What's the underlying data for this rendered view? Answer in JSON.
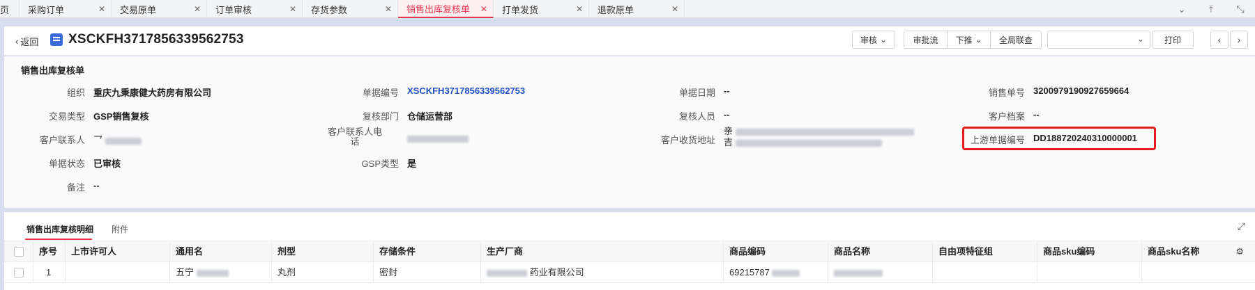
{
  "tabs": [
    {
      "label": "页",
      "closable": false
    },
    {
      "label": "采购订单",
      "closable": true
    },
    {
      "label": "交易原单",
      "closable": true
    },
    {
      "label": "订单审核",
      "closable": true
    },
    {
      "label": "存货参数",
      "closable": true
    },
    {
      "label": "销售出库复核单",
      "closable": true,
      "active": true
    },
    {
      "label": "打单发货",
      "closable": true
    },
    {
      "label": "退款原单",
      "closable": true
    }
  ],
  "header": {
    "back_label": "返回",
    "doc_number": "XSCKFH3717856339562753",
    "buttons": {
      "audit": "审核",
      "approval_flow": "审批流",
      "push_down": "下推",
      "global_link": "全局联查",
      "print_template": "",
      "print": "打印"
    }
  },
  "form": {
    "title": "销售出库复核单",
    "fields": {
      "org": {
        "label": "组织",
        "value": "重庆九秉康健大药房有限公司"
      },
      "doc_no": {
        "label": "单据编号",
        "value": "XSCKFH3717856339562753"
      },
      "doc_date": {
        "label": "单据日期",
        "value": "--"
      },
      "sales_no": {
        "label": "销售单号",
        "value": "3200979190927659664"
      },
      "trade_type": {
        "label": "交易类型",
        "value": "GSP销售复核"
      },
      "review_dept": {
        "label": "复核部门",
        "value": "仓储运营部"
      },
      "reviewer": {
        "label": "复核人员",
        "value": "--"
      },
      "customer_file": {
        "label": "客户档案",
        "value": "--"
      },
      "contact": {
        "label": "客户联系人",
        "value": "乛"
      },
      "contact_phone": {
        "label_line1": "客户联系人电",
        "label_line2": "话",
        "value": ""
      },
      "address": {
        "label": "客户收货地址",
        "value_line1": "亲",
        "value_line2": "吉"
      },
      "upstream_no": {
        "label": "上游单据编号",
        "value": "DD188720240310000001"
      },
      "doc_status": {
        "label": "单据状态",
        "value": "已审核"
      },
      "gsp_type": {
        "label": "GSP类型",
        "value": "是"
      },
      "remark": {
        "label": "备注",
        "value": "--"
      }
    }
  },
  "detail": {
    "tabs": [
      "销售出库复核明细",
      "附件"
    ],
    "columns": [
      "序号",
      "上市许可人",
      "通用名",
      "剂型",
      "存储条件",
      "生产厂商",
      "商品编码",
      "商品名称",
      "自由项特征组",
      "商品sku编码",
      "商品sku名称"
    ],
    "rows": [
      {
        "no": "1",
        "holder": "",
        "generic": "五宁",
        "form": "丸剂",
        "storage": "密封",
        "maker": "药业有限公司",
        "code": "69215787",
        "name": "",
        "free": "",
        "sku_code": "",
        "sku_name": ""
      }
    ]
  },
  "icons": {
    "tab_close": "close-icon",
    "back": "chevron-left-icon",
    "doc": "document-icon",
    "dropdown": "chevron-down-icon",
    "prev": "chevron-left-icon",
    "next": "chevron-right-icon",
    "expand": "expand-icon",
    "column_settings": "column-settings-icon"
  },
  "colors": {
    "accent": "#e8364b",
    "link": "#1f4fc5",
    "highlight_box": "#e51b1b",
    "doc_icon": "#3a6bd9"
  }
}
